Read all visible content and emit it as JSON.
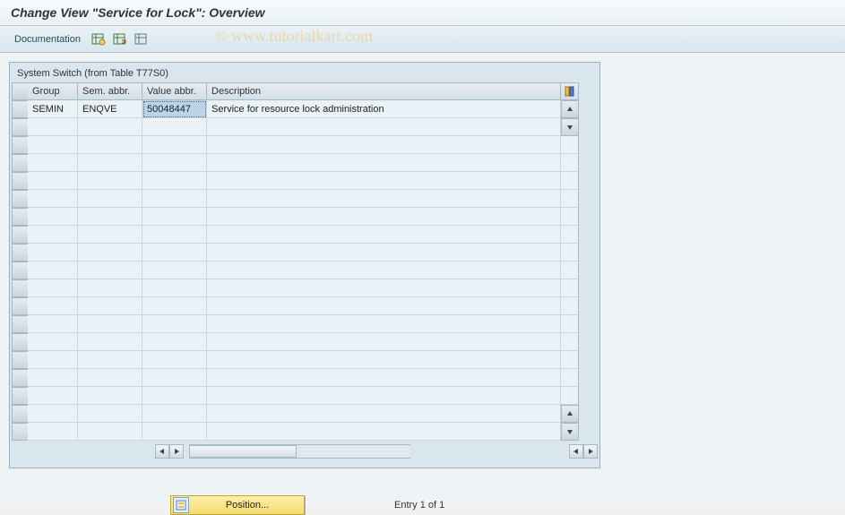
{
  "page": {
    "title": "Change View \"Service for Lock\": Overview"
  },
  "toolbar": {
    "documentation_label": "Documentation"
  },
  "watermark": "© www.tutorialkart.com",
  "pane": {
    "title": "System Switch (from Table T77S0)"
  },
  "columns": {
    "group": "Group",
    "sem_abbr": "Sem. abbr.",
    "value_abbr": "Value abbr.",
    "description": "Description"
  },
  "rows": [
    {
      "group": "SEMIN",
      "sem_abbr": "ENQVE",
      "value_abbr": "50048447",
      "description": "Service for resource lock administration"
    }
  ],
  "bottom": {
    "position_label": "Position...",
    "entry_status": "Entry 1 of 1"
  }
}
